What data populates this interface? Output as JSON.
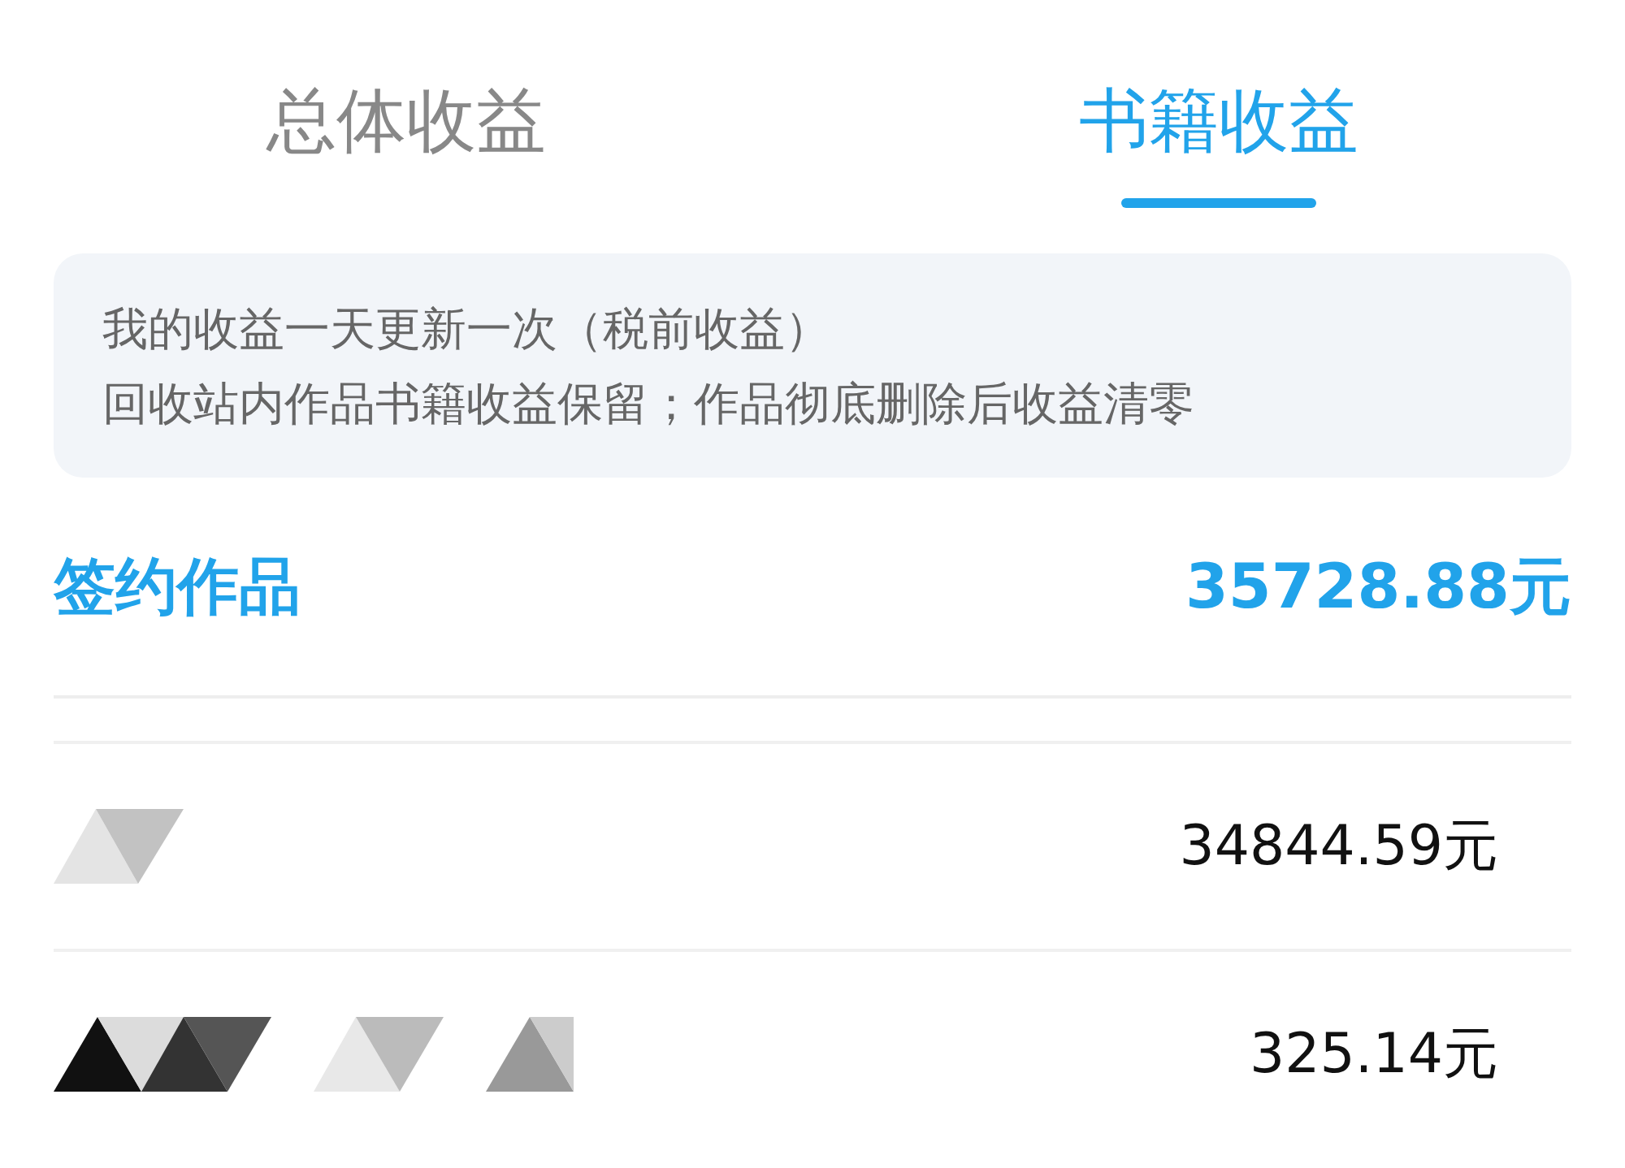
{
  "tabs": [
    {
      "label": "总体收益",
      "selected": false
    },
    {
      "label": "书籍收益",
      "selected": true
    }
  ],
  "notice": {
    "lines": [
      "我的收益一天更新一次（税前收益）",
      "回收站内作品书籍收益保留；作品彻底删除后收益清零"
    ]
  },
  "summary": {
    "label": "签约作品",
    "amount": "35728.88元"
  },
  "books": [
    {
      "amount": "34844.59元"
    },
    {
      "amount": "325.14元"
    }
  ]
}
